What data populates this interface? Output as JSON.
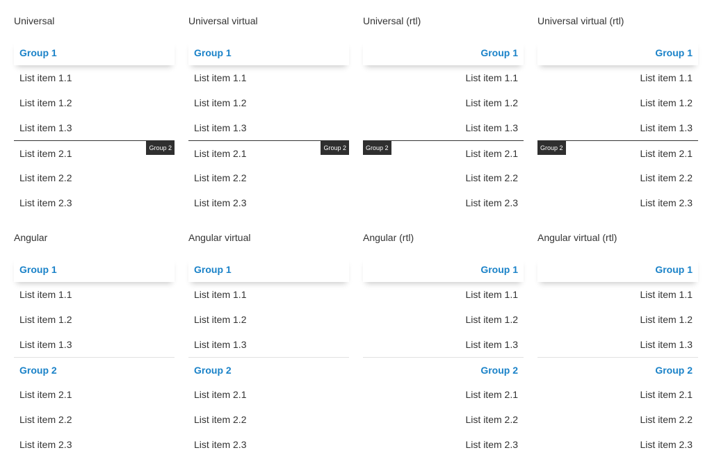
{
  "panels": [
    {
      "title": "Universal",
      "dir": "ltr",
      "style": "floating"
    },
    {
      "title": "Universal virtual",
      "dir": "ltr",
      "style": "floating"
    },
    {
      "title": "Universal (rtl)",
      "dir": "rtl",
      "style": "floating"
    },
    {
      "title": "Universal virtual (rtl)",
      "dir": "rtl",
      "style": "floating"
    },
    {
      "title": "Angular",
      "dir": "ltr",
      "style": "inline"
    },
    {
      "title": "Angular virtual",
      "dir": "ltr",
      "style": "inline"
    },
    {
      "title": "Angular (rtl)",
      "dir": "rtl",
      "style": "inline"
    },
    {
      "title": "Angular virtual (rtl)",
      "dir": "rtl",
      "style": "inline"
    }
  ],
  "groups": [
    {
      "label": "Group 1",
      "items": [
        "List item 1.1",
        "List item 1.2",
        "List item 1.3"
      ]
    },
    {
      "label": "Group 2",
      "items": [
        "List item 2.1",
        "List item 2.2",
        "List item 2.3"
      ]
    }
  ],
  "colors": {
    "group_header": "#1a82c8",
    "floating_tag_bg": "#2f2f2f"
  }
}
